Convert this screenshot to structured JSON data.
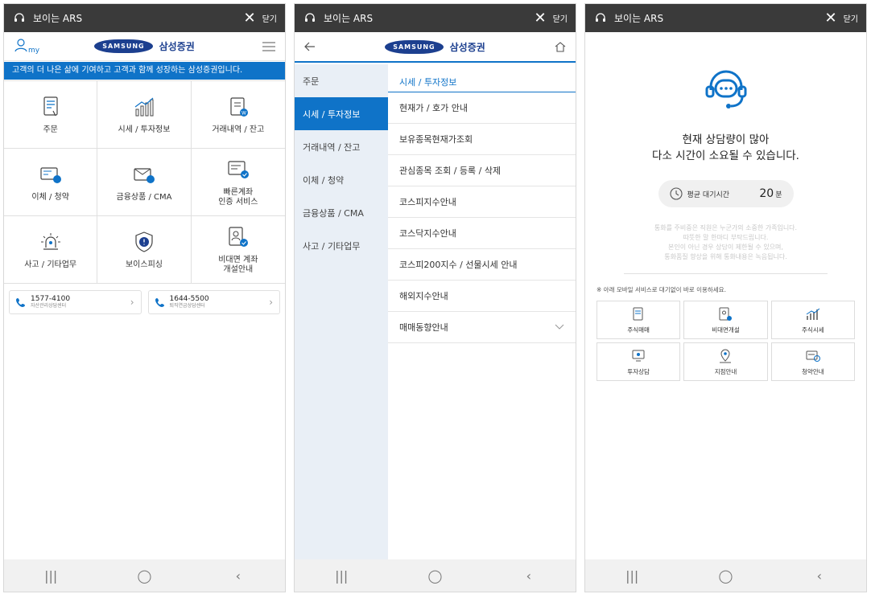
{
  "top": {
    "title": "보이는 ARS",
    "close_label": "닫기"
  },
  "screen1": {
    "my_label": "my",
    "samsung": "SAMSUNG",
    "brand": "삼성증권",
    "banner": "고객의 더 나은 삶에 기여하고 고객과 함께 성장하는 삼성증권입니다.",
    "grid": [
      {
        "label": "주문",
        "icon": "order-icon"
      },
      {
        "label": "시세 / 투자정보",
        "icon": "chart-icon"
      },
      {
        "label": "거래내역 / 잔고",
        "icon": "clipboard-icon"
      },
      {
        "label": "이체 / 청약",
        "icon": "transfer-icon"
      },
      {
        "label": "금융상품 / CMA",
        "icon": "product-icon"
      },
      {
        "label1": "빠른계좌",
        "label2": "인증 서비스",
        "icon": "quick-account-icon"
      },
      {
        "label": "사고 / 기타업무",
        "icon": "alarm-icon"
      },
      {
        "label": "보이스피싱",
        "icon": "shield-icon"
      },
      {
        "label1": "비대면 계좌",
        "label2": "개설안내",
        "icon": "non-face-account-icon"
      }
    ],
    "calls": [
      {
        "number": "1577-4100",
        "sub": "자산관리상담센터"
      },
      {
        "number": "1644-5500",
        "sub": "퇴직연금상담센터"
      }
    ]
  },
  "screen2": {
    "samsung": "SAMSUNG",
    "brand": "삼성증권",
    "sidebar": [
      "주문",
      "시세 / 투자정보",
      "거래내역 / 잔고",
      "이체 / 청약",
      "금융상품 / CMA",
      "사고 / 기타업무"
    ],
    "active_index": 1,
    "submenu_header": "시세 / 투자정보",
    "submenu": [
      "현재가 / 호가 안내",
      "보유종목현재가조회",
      "관심종목 조회 / 등록 / 삭제",
      "코스피지수안내",
      "코스닥지수안내",
      "코스피200지수 / 선물시세 안내",
      "해외지수안내",
      "매매동향안내"
    ]
  },
  "screen3": {
    "msg_line1": "현재 상담량이 많아",
    "msg_line2": "다소 시간이 소요될 수 있습니다.",
    "wait_label": "평균 대기시간",
    "wait_value": "20",
    "wait_unit": "분",
    "faint1": "통화를 주비중은 직원은 누군가의 소중한 가족입니다.",
    "faint2": "따뜻한 말 한마디 부탁드립니다.",
    "faint3": "본인이 아닌 경우 상담이 제한될 수 있으며,",
    "faint4": "통화품질 향상을 위해 통화내용은 녹음됩니다.",
    "note": "※ 아래 모바일 서비스로 대기없이 바로 이용하세요.",
    "services": [
      "주식매매",
      "비대면개설",
      "주식시세",
      "투자상담",
      "지점안내",
      "청약안내"
    ]
  },
  "colors": {
    "accent": "#0f73c8",
    "dark_bar": "#3a3a3a",
    "samsung_blue": "#1c3f8f"
  }
}
